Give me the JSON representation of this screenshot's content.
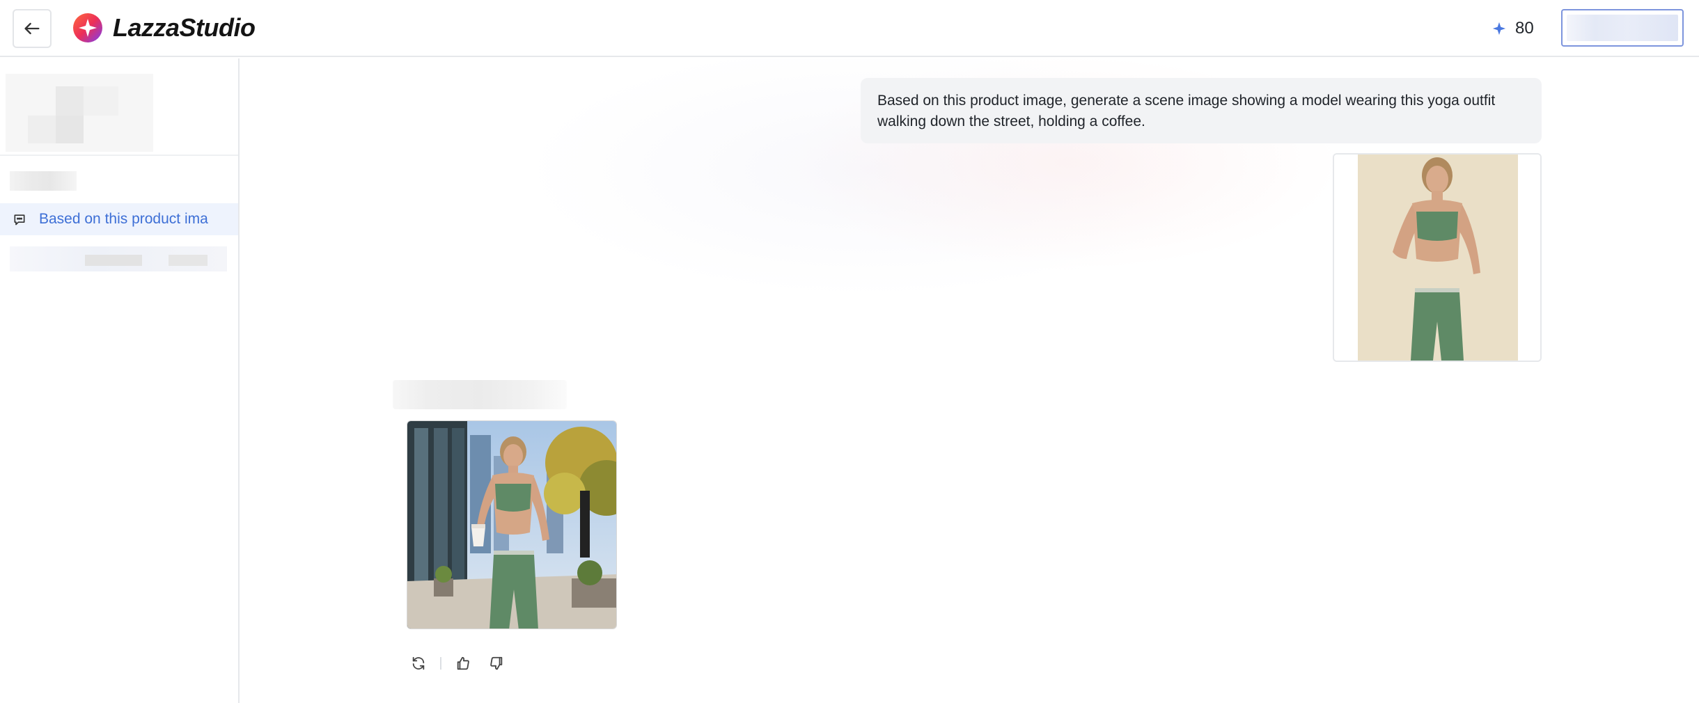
{
  "header": {
    "brand_name": "LazzaStudio",
    "credits": "80",
    "icons": {
      "back": "arrow-left-icon",
      "credits": "sparkle-icon",
      "logo": "brand-logo-icon"
    }
  },
  "sidebar": {
    "active_conversation": {
      "label": "Based on this product ima",
      "icon": "chat-bubble-icon"
    }
  },
  "conversation": {
    "user_message": "Based on this product image, generate a scene image showing a model wearing this yoga outfit walking down the street, holding a coffee.",
    "actions": {
      "regenerate": "refresh-icon",
      "like": "thumbs-up-icon",
      "dislike": "thumbs-down-icon"
    }
  },
  "colors": {
    "accent": "#3d6fd6",
    "active_item_bg": "#eef3fd",
    "bubble_bg": "#f2f3f5",
    "outfit_green": "#5f8a66",
    "product_bg": "#eadfc7"
  }
}
